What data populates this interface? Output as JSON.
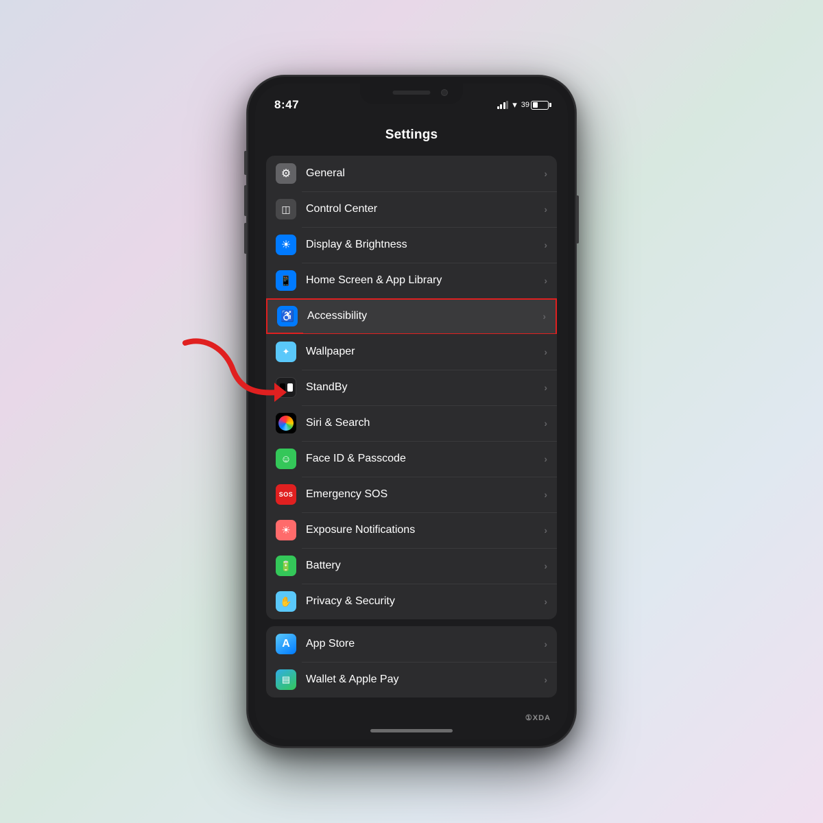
{
  "background": {
    "gradient": "linear-gradient(135deg, #d8dce8, #e8d8e8, #d8e8e0, #e0e8f0, #f0e0f0)"
  },
  "statusBar": {
    "time": "8:47",
    "batteryPercent": "39"
  },
  "header": {
    "title": "Settings"
  },
  "groups": [
    {
      "id": "group1",
      "rows": [
        {
          "id": "general",
          "label": "General",
          "iconColor": "gray",
          "iconSymbol": "⚙",
          "highlighted": false
        },
        {
          "id": "controlCenter",
          "label": "Control Center",
          "iconColor": "gray2",
          "iconSymbol": "◧",
          "highlighted": false
        },
        {
          "id": "displayBrightness",
          "label": "Display & Brightness",
          "iconColor": "blue",
          "iconSymbol": "☀",
          "highlighted": false
        },
        {
          "id": "homeScreen",
          "label": "Home Screen & App Library",
          "iconColor": "blue2",
          "iconSymbol": "📱",
          "highlighted": false
        },
        {
          "id": "accessibility",
          "label": "Accessibility",
          "iconColor": "blue",
          "iconSymbol": "♿",
          "highlighted": true
        },
        {
          "id": "wallpaper",
          "label": "Wallpaper",
          "iconColor": "blue3",
          "iconSymbol": "✦",
          "highlighted": false
        },
        {
          "id": "standby",
          "label": "StandBy",
          "iconColor": "dark",
          "iconSymbol": "standby",
          "highlighted": false
        },
        {
          "id": "siri",
          "label": "Siri & Search",
          "iconColor": "siri",
          "iconSymbol": "siri",
          "highlighted": false
        },
        {
          "id": "faceId",
          "label": "Face ID & Passcode",
          "iconColor": "green",
          "iconSymbol": "☺",
          "highlighted": false
        },
        {
          "id": "sos",
          "label": "Emergency SOS",
          "iconColor": "red",
          "iconSymbol": "sos",
          "highlighted": false
        },
        {
          "id": "exposure",
          "label": "Exposure Notifications",
          "iconColor": "coral",
          "iconSymbol": "☀",
          "highlighted": false
        },
        {
          "id": "battery",
          "label": "Battery",
          "iconColor": "green",
          "iconSymbol": "🔋",
          "highlighted": false
        },
        {
          "id": "privacy",
          "label": "Privacy & Security",
          "iconColor": "lightblue",
          "iconSymbol": "✋",
          "highlighted": false
        }
      ]
    },
    {
      "id": "group2",
      "rows": [
        {
          "id": "appStore",
          "label": "App Store",
          "iconColor": "appstore",
          "iconSymbol": "A",
          "highlighted": false
        },
        {
          "id": "wallet",
          "label": "Wallet & Apple Pay",
          "iconColor": "wallet",
          "iconSymbol": "▤",
          "highlighted": false
        }
      ]
    }
  ],
  "chevron": "›",
  "watermark": "①XDA"
}
